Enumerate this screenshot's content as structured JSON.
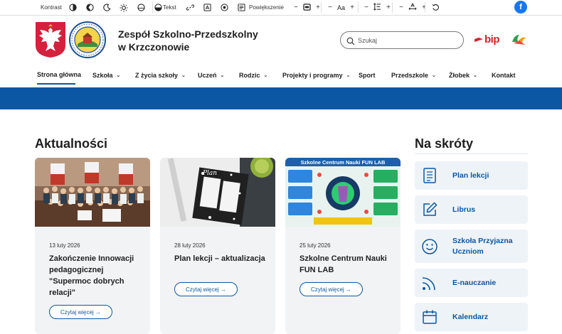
{
  "toolbar": {
    "contrast_label": "Kontrast",
    "text_label": "Tekst",
    "zoom_label": "Powiększenie",
    "font_size_label": "Aa",
    "minus": "−",
    "plus": "+",
    "facebook_label": "f"
  },
  "header": {
    "school_name_line1": "Zespół Szkolno-Przedszkolny",
    "school_name_line2": "w Krzczonowie",
    "search_placeholder": "Szukaj",
    "bip_text": "bip"
  },
  "nav": {
    "items": [
      {
        "label": "Strona główna",
        "chevron": "",
        "active": true
      },
      {
        "label": "Szkoła",
        "chevron": "⌄"
      },
      {
        "label": "Z życia szkoły",
        "chevron": "⌄"
      },
      {
        "label": "Uczeń",
        "chevron": "⌄"
      },
      {
        "label": "Rodzic",
        "chevron": "⌄"
      },
      {
        "label": "Projekty i programy",
        "chevron": "⌄"
      },
      {
        "label": "Sport",
        "chevron": ""
      },
      {
        "label": "Przedszkole",
        "chevron": "⌄"
      },
      {
        "label": "Żłobek",
        "chevron": "⌄"
      },
      {
        "label": "Kontakt",
        "chevron": ""
      }
    ]
  },
  "news": {
    "title": "Aktualności",
    "button_label": "Czytaj więcej →",
    "cards": [
      {
        "date": "13 luty 2026",
        "title": "Zakończenie Innowacji pedagogicznej \"Supermoc dobrych relacji\""
      },
      {
        "date": "28 luty 2026",
        "title": "Plan lekcji – aktualizacja"
      },
      {
        "date": "25 luty 2026",
        "title": "Szkolne Centrum Nauki FUN LAB"
      }
    ],
    "poster_heading": "Szkolne Centrum Nauki FUN LAB"
  },
  "shortcuts": {
    "title": "Na skróty",
    "items": [
      {
        "label": "Plan lekcji",
        "icon": "document-icon"
      },
      {
        "label": "Librus",
        "icon": "edit-icon"
      },
      {
        "label": "Szkoła Przyjazna Uczniom",
        "icon": "smile-icon"
      },
      {
        "label": "E-nauczanie",
        "icon": "signal-icon"
      },
      {
        "label": "Kalendarz",
        "icon": "calendar-icon"
      }
    ]
  },
  "colors": {
    "primary": "#0b57a4",
    "card_bg": "#f1f3f5",
    "shortcut_bg": "#eef3f8",
    "bip_red": "#d2232a"
  }
}
